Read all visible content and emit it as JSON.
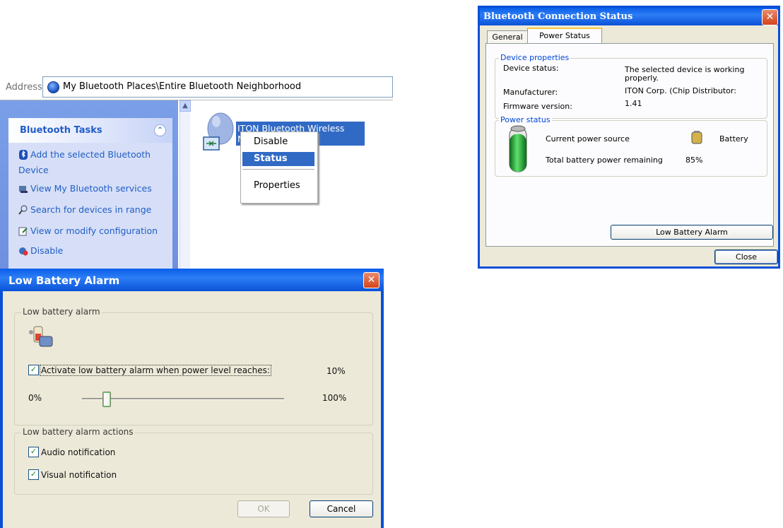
{
  "explorer": {
    "address_label": "Address",
    "address_value": "My Bluetooth Places\\Entire Bluetooth Neighborhood",
    "tasks_title": "Bluetooth Tasks",
    "tasks": [
      {
        "label": "Add the selected Bluetooth",
        "label2": "Device",
        "icon": "bluetooth-icon"
      },
      {
        "label": "View My Bluetooth services",
        "icon": "services-icon"
      },
      {
        "label": "Search for devices in range",
        "icon": "search-icon"
      },
      {
        "label": "View or modify configuration",
        "icon": "configuration-icon"
      },
      {
        "label": "Disable",
        "icon": "disable-icon"
      }
    ],
    "device_label": "ITON Bluetooth Wireless Mouse",
    "context_menu": [
      "Disable",
      "Status",
      "Properties"
    ]
  },
  "bt_status": {
    "title": "Bluetooth Connection Status",
    "tabs": [
      "General",
      "Power Status"
    ],
    "active_tab": "Power Status",
    "device_properties_title": "Device properties",
    "device_status_label": "Device status:",
    "device_status_value_line1": "The selected device is working",
    "device_status_value_line2": "properly.",
    "manufacturer_label": "Manufacturer:",
    "manufacturer_value": "ITON Corp. (Chip Distributor:",
    "firmware_label": "Firmware version:",
    "firmware_value": "1.41",
    "power_status_title": "Power status",
    "power_source_label": "Current power source",
    "power_source_value": "Battery",
    "battery_remaining_label": "Total battery power remaining",
    "battery_remaining_value": "85%",
    "battery_level": 0.85,
    "low_battery_alarm_button": "Low Battery Alarm",
    "close_button": "Close"
  },
  "low_battery": {
    "title": "Low Battery Alarm",
    "alarm_group_title": "Low battery alarm",
    "activate_label": "Activate low battery alarm when power level reaches:",
    "activate_checked": true,
    "threshold_value": "10%",
    "slider_min_label": "0%",
    "slider_max_label": "100%",
    "slider_level": 0.1,
    "actions_group_title": "Low battery alarm actions",
    "audio_label": "Audio notification",
    "audio_checked": true,
    "visual_label": "Visual notification",
    "visual_checked": true,
    "ok_button": "OK",
    "cancel_button": "Cancel"
  },
  "colors": {
    "xp_blue": "#0a4fd8",
    "selection": "#316ac5",
    "task_link": "#215dc6",
    "dialog_bg": "#ece9d8"
  }
}
